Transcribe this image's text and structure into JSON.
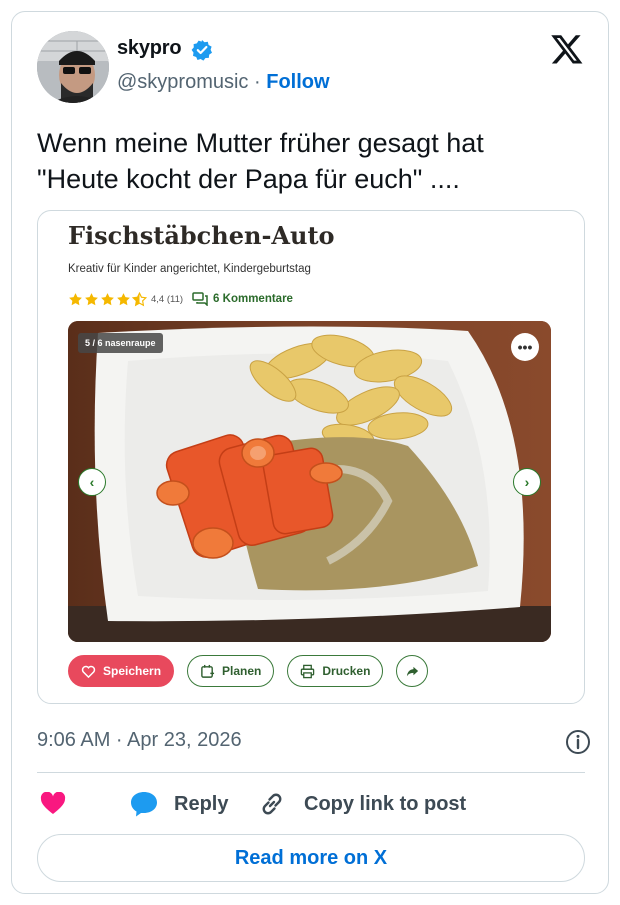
{
  "author": {
    "name": "skypro",
    "handle": "@skypromusic",
    "separator": "·",
    "follow_label": "Follow",
    "verified": true
  },
  "tweet": {
    "text_line1": "Wenn meine Mutter früher gesagt hat",
    "text_line2": "\"Heute kocht der Papa für euch\" ...."
  },
  "recipe": {
    "title": "Fischstäbchen-Auto",
    "subtitle": "Kreativ für Kinder angerichtet, Kindergeburtstag",
    "rating_value": 4.4,
    "rating_text": "4,4 (11)",
    "comments_label": "6 Kommentare",
    "photo_badge": "5 / 6 nasenraupe",
    "actions": {
      "save": "Speichern",
      "plan": "Planen",
      "print": "Drucken"
    }
  },
  "meta": {
    "timestamp": "9:06 AM · Apr 23, 2026"
  },
  "actions": {
    "reply_label": "Reply",
    "copy_label": "Copy link to post"
  },
  "footer": {
    "read_more_label": "Read more on X"
  },
  "icons": {
    "logo": "x-logo-icon",
    "verified": "verified-badge-icon",
    "like": "heart-icon",
    "reply": "speech-bubble-icon",
    "copy": "link-icon",
    "info": "info-icon"
  },
  "colors": {
    "link_blue": "#006fd6",
    "verified_blue": "#1d9bf0",
    "like_pink": "#f91880",
    "reply_blue": "#1d9bf0",
    "star_yellow": "#f5b800",
    "save_red": "#e8495d",
    "recipe_green": "#3b7a3b"
  }
}
